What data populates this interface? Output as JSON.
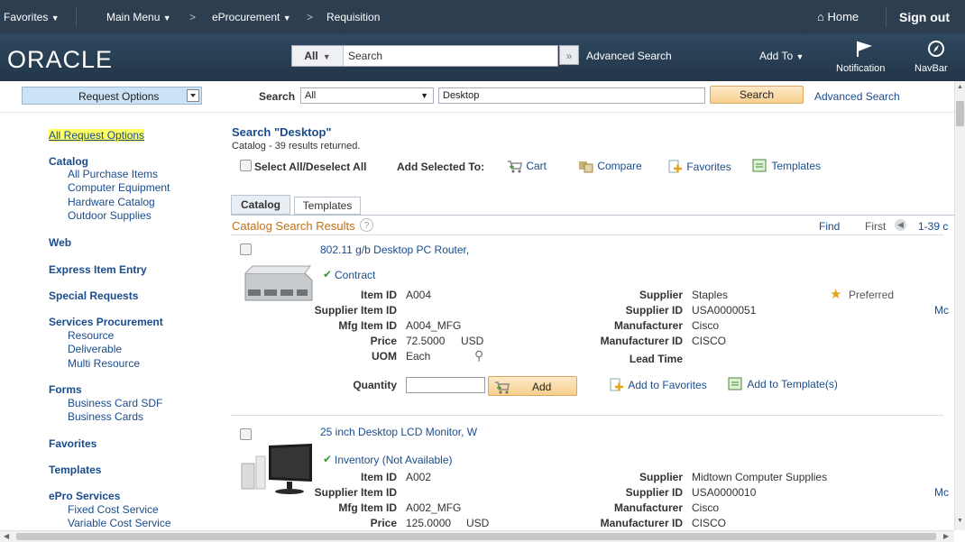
{
  "topnav": {
    "favorites": "Favorites",
    "main_menu": "Main Menu",
    "chevron": ">",
    "eprocurement": "eProcurement",
    "requisition": "Requisition",
    "home": "Home",
    "signout": "Sign out"
  },
  "header": {
    "logo": "ORACLE",
    "search_scope": "All",
    "search_placeholder": "Search",
    "advanced_search": "Advanced Search",
    "add_to": "Add To",
    "notification": "Notification",
    "navbar": "NavBar"
  },
  "toolbar": {
    "request_options": "Request Options",
    "search_label": "Search",
    "scope": "All",
    "query": "Desktop",
    "search_btn": "Search",
    "advanced_search": "Advanced Search"
  },
  "leftnav": {
    "all_request_options": "All Request Options",
    "catalog": "Catalog",
    "catalog_items": [
      "All Purchase Items",
      "Computer Equipment",
      "Hardware Catalog",
      "Outdoor Supplies"
    ],
    "web": "Web",
    "express": "Express Item Entry",
    "special": "Special Requests",
    "services": "Services Procurement",
    "services_items": [
      "Resource",
      "Deliverable",
      "Multi Resource"
    ],
    "forms": "Forms",
    "forms_items": [
      "Business Card SDF",
      "Business Cards"
    ],
    "favorites": "Favorites",
    "templates": "Templates",
    "epro": "ePro Services",
    "epro_items": [
      "Fixed Cost Service",
      "Variable Cost Service"
    ]
  },
  "results": {
    "title": "Search \"Desktop\"",
    "count": "Catalog - 39 results returned.",
    "select_all": "Select All/Deselect All",
    "add_selected": "Add Selected To:",
    "cart": "Cart",
    "compare": "Compare",
    "favorites": "Favorites",
    "templates": "Templates",
    "tab_catalog": "Catalog",
    "tab_templates": "Templates",
    "section_title": "Catalog Search Results",
    "find": "Find",
    "first": "First",
    "range": "1-39 c"
  },
  "labels": {
    "item_id": "Item ID",
    "supplier_item_id": "Supplier Item ID",
    "mfg_item_id": "Mfg Item ID",
    "price": "Price",
    "uom": "UOM",
    "quantity": "Quantity",
    "supplier": "Supplier",
    "supplier_id": "Supplier ID",
    "manufacturer": "Manufacturer",
    "manufacturer_id": "Manufacturer ID",
    "lead_time": "Lead Time",
    "add": "Add",
    "add_to_favorites": "Add to Favorites",
    "add_to_templates": "Add to Template(s)",
    "more": "Mc"
  },
  "items": [
    {
      "title": "802.11 g/b Desktop PC Router,",
      "status": "Contract",
      "item_id": "A004",
      "mfg_item_id": "A004_MFG",
      "price": "72.5000",
      "currency": "USD",
      "uom": "Each",
      "supplier": "Staples",
      "supplier_id": "USA0000051",
      "manufacturer": "Cisco",
      "manufacturer_id": "CISCO",
      "preferred": "Preferred"
    },
    {
      "title": "25 inch Desktop LCD Monitor, W",
      "status": "Inventory (Not Available)",
      "item_id": "A002",
      "mfg_item_id": "A002_MFG",
      "price": "125.0000",
      "currency": "USD",
      "supplier": "Midtown Computer Supplies",
      "supplier_id": "USA0000010",
      "manufacturer": "Cisco",
      "manufacturer_id": "CISCO"
    }
  ],
  "colors": {
    "topnav": "#2d3e50",
    "header": "#2a4258",
    "link": "#1a4c8c",
    "section_title": "#c0701a",
    "highlight": "#ffff66",
    "check": "#3a9a3a"
  }
}
